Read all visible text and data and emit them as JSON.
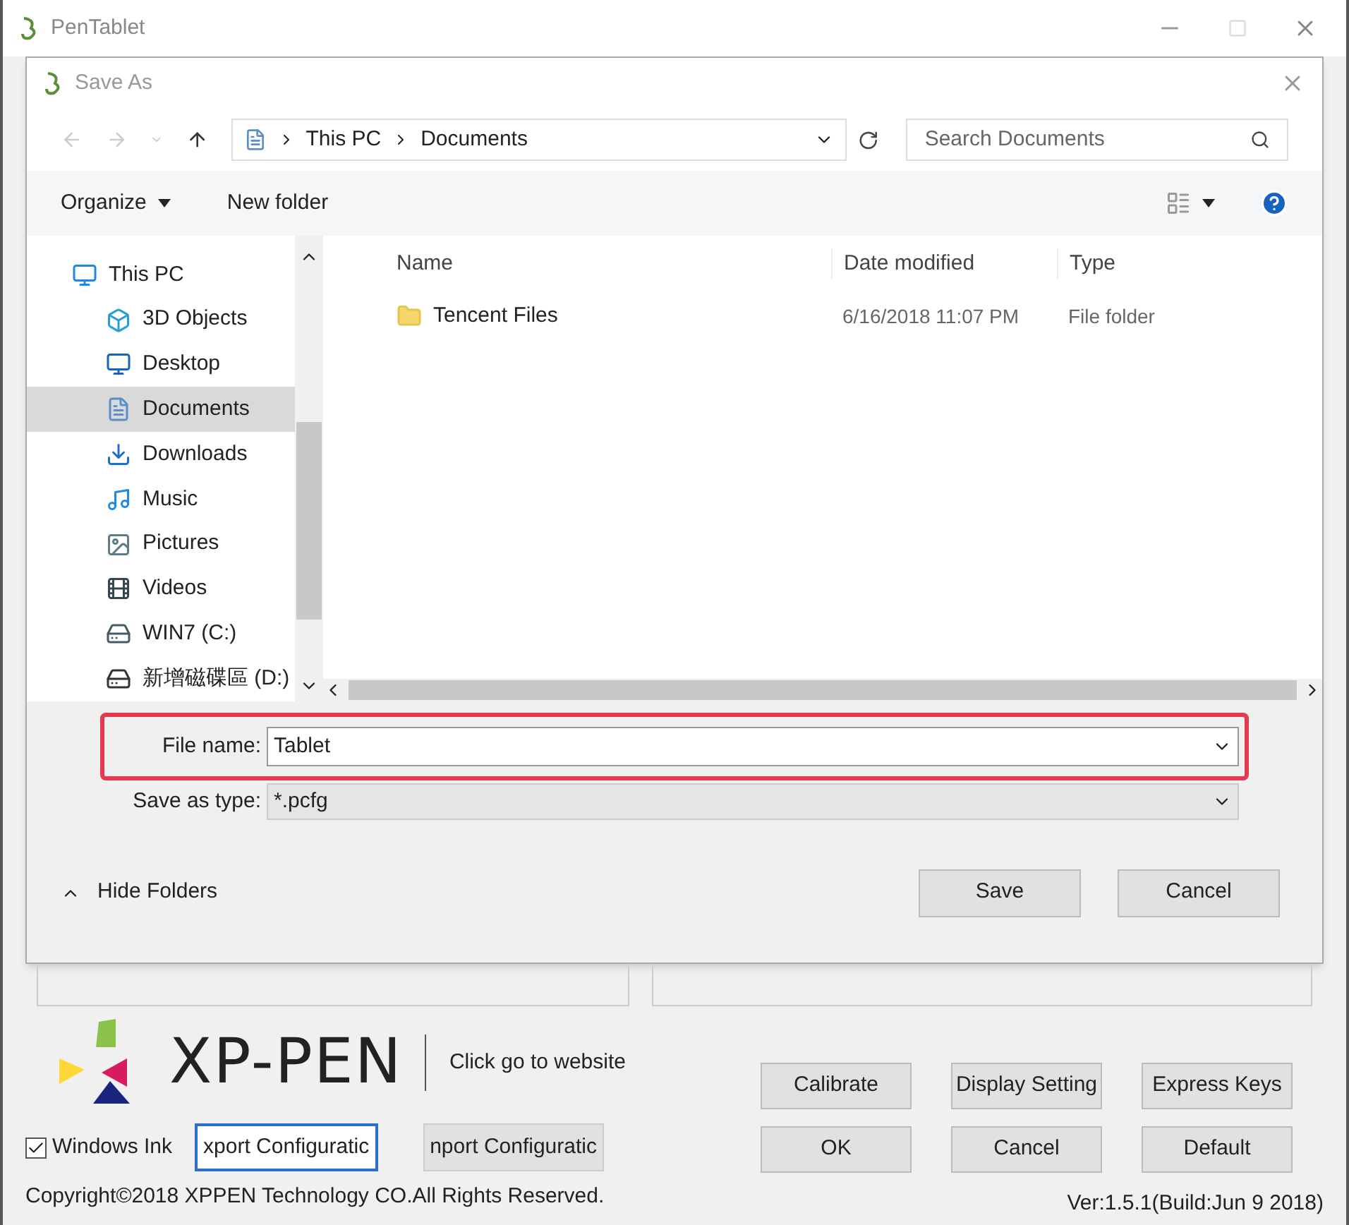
{
  "window": {
    "title": "PenTablet"
  },
  "dialog": {
    "title": "Save As",
    "address": {
      "crumbs": [
        "This PC",
        "Documents"
      ]
    },
    "search": {
      "placeholder": "Search Documents"
    },
    "toolbar": {
      "organize": "Organize",
      "new_folder": "New folder"
    },
    "sidebar": {
      "items": [
        {
          "label": "This PC",
          "kind": "pc",
          "selected": false
        },
        {
          "label": "3D Objects",
          "kind": "objects",
          "selected": false
        },
        {
          "label": "Desktop",
          "kind": "desktop",
          "selected": false
        },
        {
          "label": "Documents",
          "kind": "documents",
          "selected": true
        },
        {
          "label": "Downloads",
          "kind": "downloads",
          "selected": false
        },
        {
          "label": "Music",
          "kind": "music",
          "selected": false
        },
        {
          "label": "Pictures",
          "kind": "pictures",
          "selected": false
        },
        {
          "label": "Videos",
          "kind": "videos",
          "selected": false
        },
        {
          "label": "WIN7 (C:)",
          "kind": "drive",
          "selected": false
        },
        {
          "label": "新增磁碟區 (D:)",
          "kind": "disk",
          "selected": false
        }
      ]
    },
    "table": {
      "columns": [
        "Name",
        "Date modified",
        "Type"
      ],
      "rows": [
        {
          "name": "Tencent Files",
          "date": "6/16/2018 11:07 PM",
          "type": "File folder"
        }
      ]
    },
    "file_name": {
      "label": "File name:",
      "value": "Tablet"
    },
    "save_type": {
      "label": "Save as type:",
      "value": "*.pcfg"
    },
    "hide_folders": "Hide Folders",
    "buttons": [
      "Save",
      "Cancel"
    ]
  },
  "logo": {
    "text": "XP-PEN",
    "link": "Click go to website"
  },
  "windows_ink": {
    "label": "Windows Ink",
    "checked": true
  },
  "buttons": [
    {
      "label": "xport Configuratic",
      "focused": true
    },
    {
      "label": "nport Configuratic",
      "focused": false
    }
  ],
  "grid_buttons": [
    "Calibrate",
    "Display Setting",
    "Express Keys",
    "OK",
    "Cancel",
    "Default"
  ],
  "copyright": "Copyright©2018  XPPEN Technology CO.All Rights Reserved.",
  "version": "Ver:1.5.1(Build:Jun  9 2018)"
}
